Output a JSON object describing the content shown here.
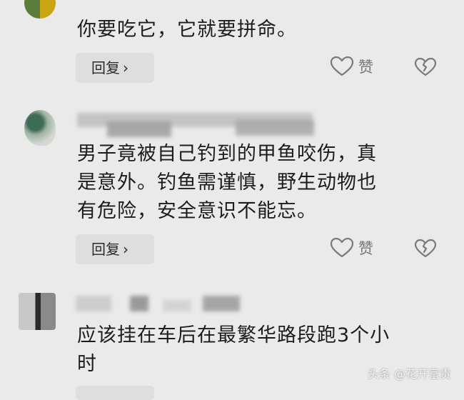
{
  "comments": [
    {
      "text": "你要吃它，它就要拼命。",
      "reply_label": "回复",
      "like_label": "赞"
    },
    {
      "text_lines": [
        "男子竟被自己钓到的甲鱼咬伤，真",
        "是意外。钓鱼需谨慎，野生动物也",
        "有危险，安全意识不能忘。"
      ],
      "reply_label": "回复",
      "like_label": "赞"
    },
    {
      "text_lines": [
        "应该挂在车后在最繁华路段跑3个小",
        "时"
      ]
    }
  ],
  "watermark": "头条 @花开富贵",
  "icons": {
    "chevron": "chevron-right-icon",
    "like": "heart-outline-icon",
    "dislike": "broken-heart-icon"
  },
  "colors": {
    "background": "#eaeaea",
    "reply_bg": "#dedede",
    "icon_gray": "#7a7a7a"
  }
}
